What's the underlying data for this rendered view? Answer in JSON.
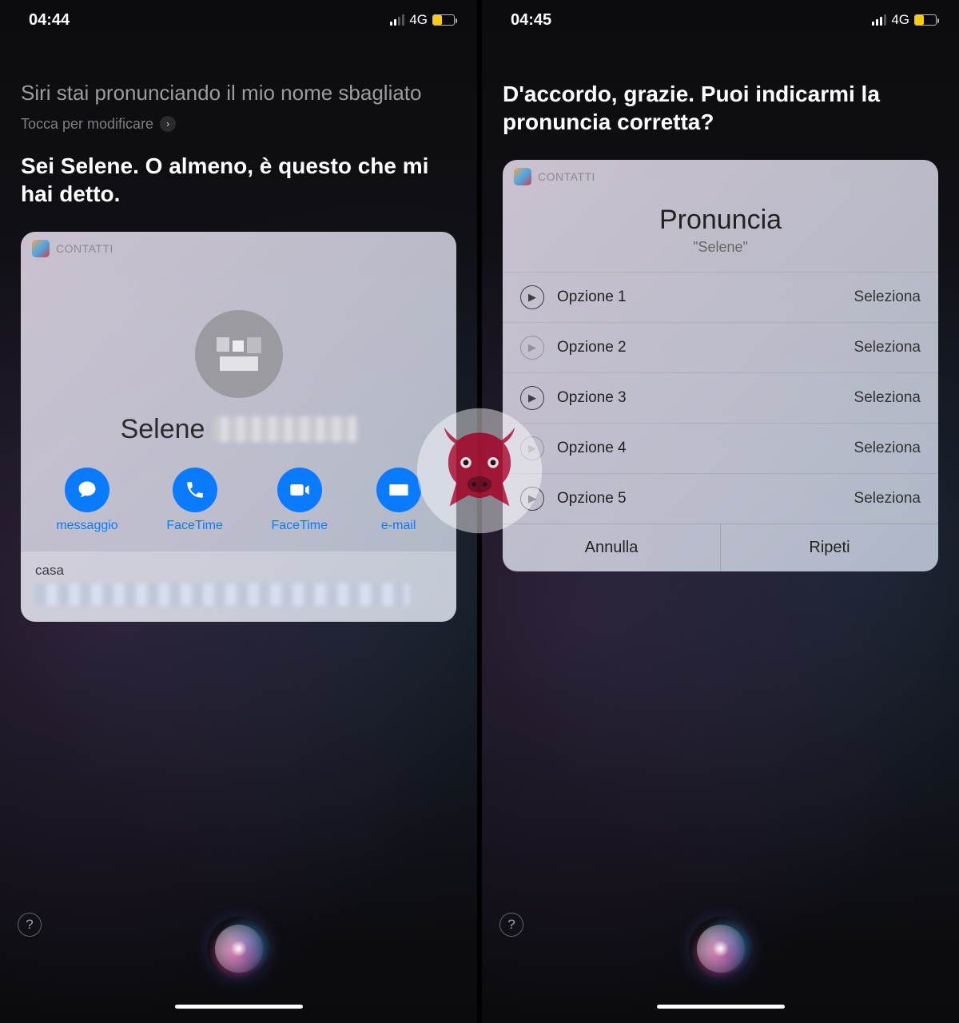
{
  "left": {
    "status": {
      "time": "04:44",
      "network": "4G"
    },
    "userUtterance": "Siri stai pronunciando il mio nome sbagliato",
    "editHint": "Tocca per modificare",
    "siriReply": "Sei Selene. O almeno, è questo che mi hai detto.",
    "card": {
      "app": "CONTATTI",
      "contactName": "Selene",
      "actions": [
        {
          "id": "message",
          "label": "messaggio"
        },
        {
          "id": "call",
          "label": "FaceTime"
        },
        {
          "id": "video",
          "label": "FaceTime"
        },
        {
          "id": "email",
          "label": "e-mail"
        }
      ],
      "sectionLabel": "casa"
    }
  },
  "right": {
    "status": {
      "time": "04:45",
      "network": "4G"
    },
    "siriReply": "D'accordo, grazie. Puoi indicarmi la pronuncia corretta?",
    "card": {
      "app": "CONTATTI",
      "title": "Pronuncia",
      "subtitle": "\"Selene\"",
      "options": [
        {
          "label": "Opzione 1",
          "action": "Seleziona"
        },
        {
          "label": "Opzione 2",
          "action": "Seleziona"
        },
        {
          "label": "Opzione 3",
          "action": "Seleziona"
        },
        {
          "label": "Opzione 4",
          "action": "Seleziona"
        },
        {
          "label": "Opzione 5",
          "action": "Seleziona"
        }
      ],
      "footer": {
        "cancel": "Annulla",
        "repeat": "Ripeti"
      }
    }
  },
  "help": "?"
}
